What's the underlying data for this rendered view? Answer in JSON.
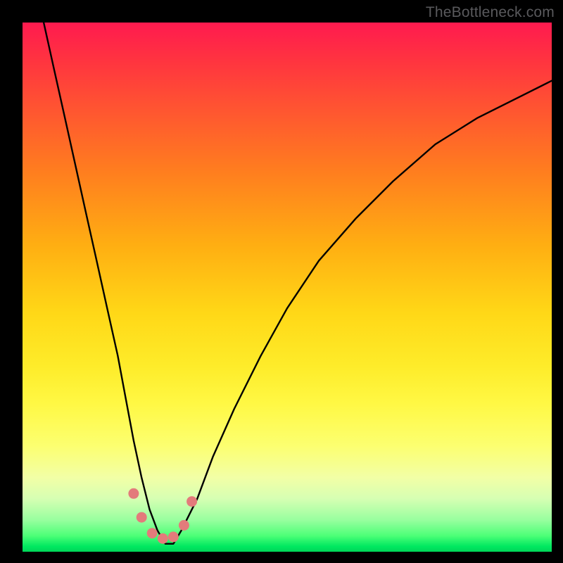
{
  "watermark_text": "TheBottleneck.com",
  "colors": {
    "frame_bg": "#000000",
    "gradient_top": "#ff1a4f",
    "gradient_bottom": "#00d659",
    "curve_stroke": "#000000",
    "marker_fill": "#e37b7b"
  },
  "chart_data": {
    "type": "line",
    "title": "",
    "xlabel": "",
    "ylabel": "",
    "xlim": [
      0,
      100
    ],
    "ylim": [
      0,
      100
    ],
    "note": "No numeric axes or tick labels are visible; x/y are normalized 0-100 estimates of the drawn curve position. y=100 is the top (red) and y=0 is the bottom (green).",
    "series": [
      {
        "name": "curve",
        "x": [
          4,
          6,
          8,
          10,
          12,
          14,
          16,
          18,
          19.5,
          21,
          22.5,
          24,
          25.5,
          27,
          28.5,
          30,
          33,
          36,
          40,
          45,
          50,
          56,
          63,
          70,
          78,
          86,
          94,
          100
        ],
        "y": [
          100,
          91,
          82,
          73,
          64,
          55,
          46,
          37,
          29,
          21,
          14,
          8,
          4,
          1.5,
          1.5,
          4,
          10,
          18,
          27,
          37,
          46,
          55,
          63,
          70,
          77,
          82,
          86,
          89
        ]
      }
    ],
    "markers": [
      {
        "x": 21.0,
        "y": 11.0
      },
      {
        "x": 22.5,
        "y": 6.5
      },
      {
        "x": 24.5,
        "y": 3.5
      },
      {
        "x": 26.5,
        "y": 2.5
      },
      {
        "x": 28.5,
        "y": 2.8
      },
      {
        "x": 30.5,
        "y": 5.0
      },
      {
        "x": 32.0,
        "y": 9.5
      }
    ],
    "gradient_scale": {
      "description": "Vertical color gradient from red/pink at top through orange, yellow, to green at bottom.",
      "stops": [
        {
          "pct": 0,
          "color": "#ff1a4f"
        },
        {
          "pct": 15,
          "color": "#ff5033"
        },
        {
          "pct": 42,
          "color": "#ffae12"
        },
        {
          "pct": 65,
          "color": "#feec2a"
        },
        {
          "pct": 86,
          "color": "#d6ffb3"
        },
        {
          "pct": 100,
          "color": "#00d659"
        }
      ]
    }
  }
}
